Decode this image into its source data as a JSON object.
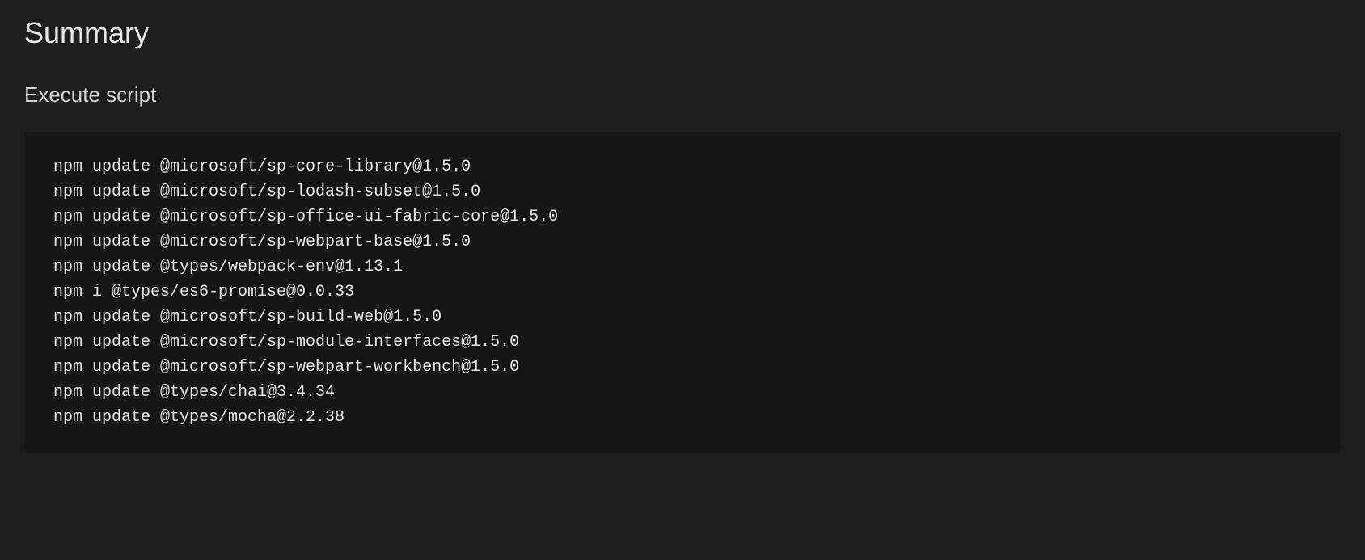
{
  "heading": "Summary",
  "subheading": "Execute script",
  "script_lines": [
    "npm update @microsoft/sp-core-library@1.5.0",
    "npm update @microsoft/sp-lodash-subset@1.5.0",
    "npm update @microsoft/sp-office-ui-fabric-core@1.5.0",
    "npm update @microsoft/sp-webpart-base@1.5.0",
    "npm update @types/webpack-env@1.13.1",
    "npm i @types/es6-promise@0.0.33",
    "npm update @microsoft/sp-build-web@1.5.0",
    "npm update @microsoft/sp-module-interfaces@1.5.0",
    "npm update @microsoft/sp-webpart-workbench@1.5.0",
    "npm update @types/chai@3.4.34",
    "npm update @types/mocha@2.2.38"
  ]
}
